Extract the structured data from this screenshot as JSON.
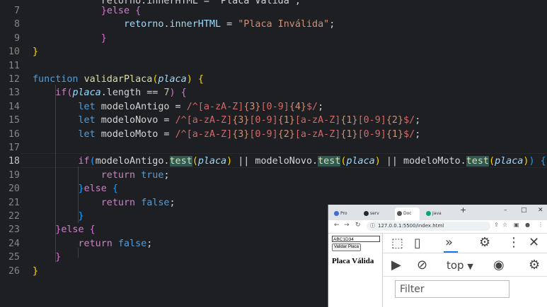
{
  "editor": {
    "lines": [
      {
        "n": "7",
        "segs": [
          [
            "            ",
            "t-op"
          ],
          [
            "}",
            "t-br2"
          ],
          [
            "else",
            "t-kw"
          ],
          [
            " ",
            "t-op"
          ],
          [
            "{",
            "t-br2"
          ]
        ]
      },
      {
        "n": "8",
        "segs": [
          [
            "                retorno",
            "t-var"
          ],
          [
            ".",
            "t-op"
          ],
          [
            "innerHTML",
            "t-var"
          ],
          [
            " = ",
            "t-op"
          ],
          [
            "\"Placa Inválida\"",
            "t-str"
          ],
          [
            ";",
            "t-op"
          ]
        ]
      },
      {
        "n": "9",
        "segs": [
          [
            "            ",
            "t-op"
          ],
          [
            "}",
            "t-br2"
          ]
        ]
      },
      {
        "n": "10",
        "segs": [
          [
            "}",
            "t-br1"
          ]
        ]
      },
      {
        "n": "11",
        "segs": []
      },
      {
        "n": "12",
        "segs": [
          [
            "function",
            "t-kw2"
          ],
          [
            " ",
            "t-op"
          ],
          [
            "validarPlaca",
            "t-fn"
          ],
          [
            "(",
            "t-br1"
          ],
          [
            "placa",
            "t-par"
          ],
          [
            ")",
            "t-br1"
          ],
          [
            " ",
            "t-op"
          ],
          [
            "{",
            "t-br1"
          ]
        ]
      },
      {
        "n": "13",
        "segs": [
          [
            "    ",
            "t-op"
          ],
          [
            "if",
            "t-kw"
          ],
          [
            "(",
            "t-br2"
          ],
          [
            "placa",
            "t-par"
          ],
          [
            ".length == ",
            "t-op"
          ],
          [
            "7",
            "t-num"
          ],
          [
            ")",
            "t-br2"
          ],
          [
            " ",
            "t-op"
          ],
          [
            "{",
            "t-br2"
          ]
        ]
      },
      {
        "n": "14",
        "segs": [
          [
            "        ",
            "t-op"
          ],
          [
            "let",
            "t-kw2"
          ],
          [
            " modeloAntigo = ",
            "t-op"
          ],
          [
            "/^[a-zA-Z]",
            "t-rx"
          ],
          [
            "{3}",
            "t-rxb"
          ],
          [
            "[0-9]",
            "t-rx"
          ],
          [
            "{4}",
            "t-rxb"
          ],
          [
            "$/",
            "t-rx"
          ],
          [
            ";",
            "t-op"
          ]
        ]
      },
      {
        "n": "15",
        "segs": [
          [
            "        ",
            "t-op"
          ],
          [
            "let",
            "t-kw2"
          ],
          [
            " modeloNovo = ",
            "t-op"
          ],
          [
            "/^[a-zA-Z]",
            "t-rx"
          ],
          [
            "{3}",
            "t-rxb"
          ],
          [
            "[0-9]",
            "t-rx"
          ],
          [
            "{1}",
            "t-rxb"
          ],
          [
            "[a-zA-Z]",
            "t-rx"
          ],
          [
            "{1}",
            "t-rxb"
          ],
          [
            "[0-9]",
            "t-rx"
          ],
          [
            "{2}",
            "t-rxb"
          ],
          [
            "$/",
            "t-rx"
          ],
          [
            ";",
            "t-op"
          ]
        ]
      },
      {
        "n": "16",
        "segs": [
          [
            "        ",
            "t-op"
          ],
          [
            "let",
            "t-kw2"
          ],
          [
            " modeloMoto = ",
            "t-op"
          ],
          [
            "/^[a-zA-Z]",
            "t-rx"
          ],
          [
            "{3}",
            "t-rxb"
          ],
          [
            "[0-9]",
            "t-rx"
          ],
          [
            "{2}",
            "t-rxb"
          ],
          [
            "[a-zA-Z]",
            "t-rx"
          ],
          [
            "{1}",
            "t-rxb"
          ],
          [
            "[0-9]",
            "t-rx"
          ],
          [
            "{1}",
            "t-rxb"
          ],
          [
            "$/",
            "t-rx"
          ],
          [
            ";",
            "t-op"
          ]
        ]
      },
      {
        "n": "17",
        "segs": []
      },
      {
        "n": "18",
        "segs": [
          [
            "        ",
            "t-op"
          ],
          [
            "if",
            "t-kw"
          ],
          [
            "(",
            "t-br3"
          ],
          [
            "modeloAntigo.",
            "t-op"
          ],
          [
            "test",
            "t-hl"
          ],
          [
            "(",
            "t-br1"
          ],
          [
            "placa",
            "t-par"
          ],
          [
            ")",
            "t-br1"
          ],
          [
            " || modeloNovo.",
            "t-op"
          ],
          [
            "test",
            "t-hl"
          ],
          [
            "(",
            "t-br1"
          ],
          [
            "placa",
            "t-par"
          ],
          [
            ")",
            "t-br1"
          ],
          [
            " || modeloMoto.",
            "t-op"
          ],
          [
            "test",
            "t-hl"
          ],
          [
            "(",
            "t-br1"
          ],
          [
            "placa",
            "t-par"
          ],
          [
            ")",
            "t-br1"
          ],
          [
            ")",
            "t-br3"
          ],
          [
            " ",
            "t-op"
          ],
          [
            "{",
            "t-br3"
          ]
        ]
      },
      {
        "n": "19",
        "segs": [
          [
            "            ",
            "t-op"
          ],
          [
            "return",
            "t-kw"
          ],
          [
            " ",
            "t-op"
          ],
          [
            "true",
            "t-kw2"
          ],
          [
            ";",
            "t-op"
          ]
        ]
      },
      {
        "n": "20",
        "segs": [
          [
            "        ",
            "t-op"
          ],
          [
            "}",
            "t-br3"
          ],
          [
            "else",
            "t-kw"
          ],
          [
            " ",
            "t-op"
          ],
          [
            "{",
            "t-br3"
          ]
        ]
      },
      {
        "n": "21",
        "segs": [
          [
            "            ",
            "t-op"
          ],
          [
            "return",
            "t-kw"
          ],
          [
            " ",
            "t-op"
          ],
          [
            "false",
            "t-kw2"
          ],
          [
            ";",
            "t-op"
          ]
        ]
      },
      {
        "n": "22",
        "segs": [
          [
            "        ",
            "t-op"
          ],
          [
            "}",
            "t-br3"
          ]
        ]
      },
      {
        "n": "23",
        "segs": [
          [
            "    ",
            "t-op"
          ],
          [
            "}",
            "t-br2"
          ],
          [
            "else",
            "t-kw"
          ],
          [
            " ",
            "t-op"
          ],
          [
            "{",
            "t-br2"
          ]
        ]
      },
      {
        "n": "24",
        "segs": [
          [
            "        ",
            "t-op"
          ],
          [
            "return",
            "t-kw"
          ],
          [
            " ",
            "t-op"
          ],
          [
            "false",
            "t-kw2"
          ],
          [
            ";",
            "t-op"
          ]
        ]
      },
      {
        "n": "25",
        "segs": [
          [
            "    ",
            "t-op"
          ],
          [
            "}",
            "t-br2"
          ]
        ]
      },
      {
        "n": "26",
        "segs": [
          [
            "}",
            "t-br1"
          ]
        ]
      }
    ],
    "partial_top_line": "            retorno.innerHTML = \"Placa Válida\";",
    "active_line": "18"
  },
  "browser": {
    "tabs": [
      {
        "label": "Pro",
        "icon_color": "#3b6fd8"
      },
      {
        "label": "serv",
        "icon_color": "#24292e"
      },
      {
        "label": "Doc",
        "icon_color": "#555555"
      },
      {
        "label": "Java",
        "icon_color": "#04aa6d"
      }
    ],
    "new_tab": "+",
    "window_controls": [
      "–",
      "□",
      "✕"
    ],
    "url": "127.0.0.1:5500/index.html",
    "page": {
      "input_value": "ABC1D34",
      "button_label": "Validar Placa",
      "result_text": "Placa Válida"
    },
    "devtools": {
      "context_selector": "top",
      "filter_placeholder": "Filter"
    }
  }
}
